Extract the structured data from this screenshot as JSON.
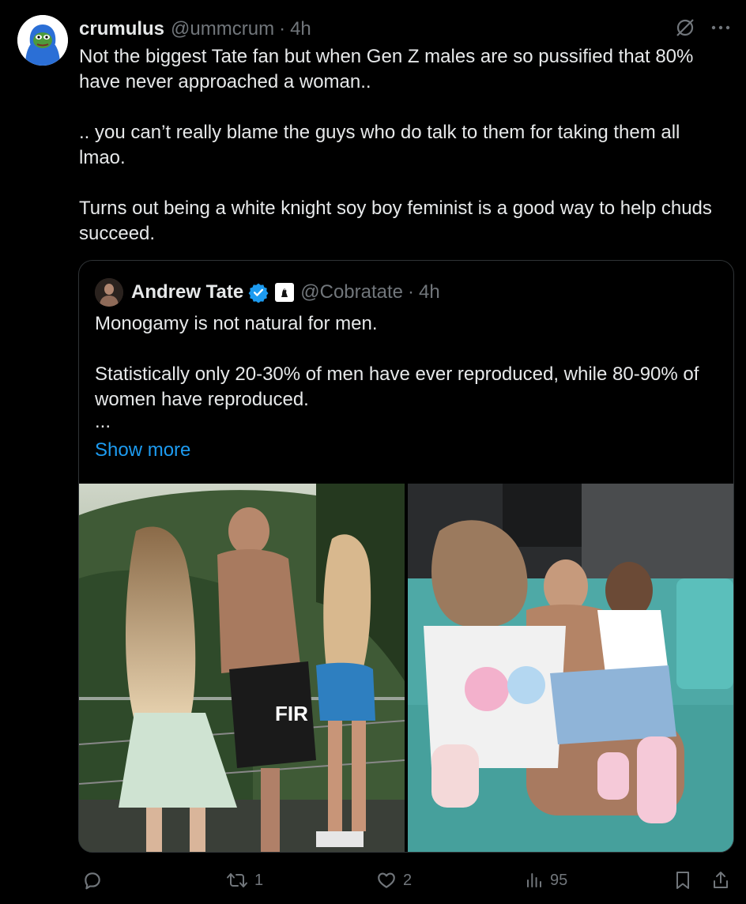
{
  "author": {
    "display_name": "crumulus",
    "handle": "@ummcrum",
    "separator": "·",
    "time": "4h",
    "avatar_icon": "pepe-hoodie-avatar"
  },
  "tweet": {
    "paragraphs": [
      "Not the biggest Tate fan but when Gen Z males are so pussified that 80% have never approached a woman..",
      ".. you can’t really blame the guys who do talk to them for taking them all lmao.",
      "Turns out being a white knight soy boy feminist is a good way to help chuds succeed."
    ]
  },
  "quoted": {
    "display_name": "Andrew Tate",
    "handle": "@Cobratate",
    "separator": "·",
    "time": "4h",
    "paragraphs": [
      "Monogamy is not natural for men.",
      "Statistically only 20-30% of men have ever reproduced, while 80-90% of women have reproduced."
    ],
    "ellipsis": "...",
    "show_more": "Show more",
    "verified_color": "#1d9bf0"
  },
  "actions": {
    "reply_count": "",
    "retweet_count": "1",
    "like_count": "2",
    "views_count": "95"
  },
  "colors": {
    "background": "#000000",
    "text": "#e7e9ea",
    "muted": "#71767b",
    "accent": "#1d9bf0",
    "border": "#2f3336"
  }
}
